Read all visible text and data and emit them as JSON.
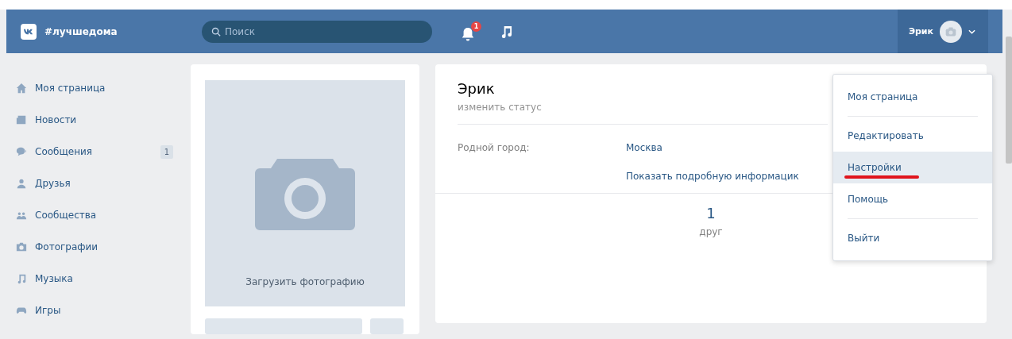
{
  "header": {
    "hashtag": "#лучшедома",
    "search": {
      "placeholder": "Поиск"
    },
    "notification_count": "1",
    "user_name": "Эрик"
  },
  "sidebar": {
    "items": [
      {
        "label": "Моя страница",
        "kind": "home"
      },
      {
        "label": "Новости",
        "kind": "news"
      },
      {
        "label": "Сообщения",
        "kind": "messages",
        "badge": "1"
      },
      {
        "label": "Друзья",
        "kind": "friends"
      },
      {
        "label": "Сообщества",
        "kind": "groups"
      },
      {
        "label": "Фотографии",
        "kind": "photos"
      },
      {
        "label": "Музыка",
        "kind": "music"
      },
      {
        "label": "Игры",
        "kind": "games"
      }
    ]
  },
  "photo_card": {
    "upload_label": "Загрузить фотографию"
  },
  "profile": {
    "name": "Эрик",
    "status_link": "изменить статус",
    "fields": [
      {
        "label": "Родной город:",
        "value": "Москва"
      }
    ],
    "more_link": "Показать подробную информацик",
    "counters": [
      {
        "value": "1",
        "label": "друг"
      }
    ]
  },
  "dropdown": {
    "items": [
      {
        "label": "Моя страница",
        "selected": false,
        "underlined": false
      },
      {
        "label": "Редактировать",
        "selected": false,
        "underlined": false
      },
      {
        "label": "Настройки",
        "selected": true,
        "underlined": true
      },
      {
        "label": "Помощь",
        "selected": false,
        "underlined": false
      },
      {
        "label": "Выйти",
        "selected": false,
        "underlined": false
      }
    ]
  }
}
